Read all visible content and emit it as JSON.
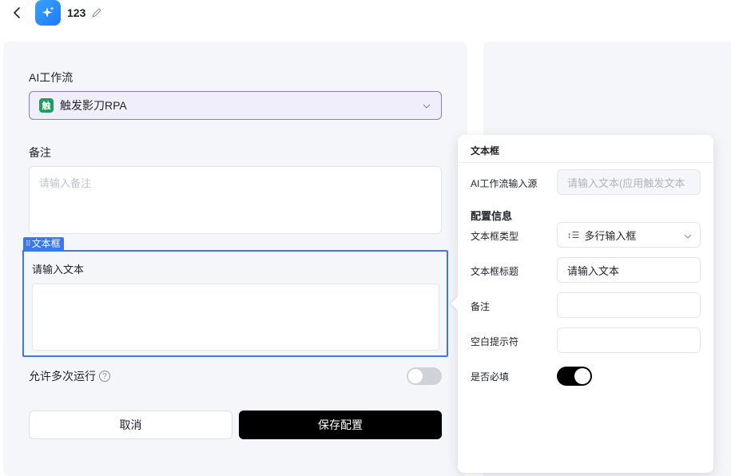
{
  "header": {
    "title": "123",
    "back_icon": "chevron-left-icon",
    "edit_icon": "pencil-icon",
    "app_icon": "sparkle-icon"
  },
  "form": {
    "workflow_label": "AI工作流",
    "workflow_value": "触发影刀RPA",
    "workflow_icon_text": "触",
    "remark_label": "备注",
    "remark_placeholder": "请输入备注",
    "textbox_tag": "文本框",
    "textbox_label": "请输入文本",
    "multi_run_label": "允许多次运行",
    "multi_run_enabled": false,
    "cancel_label": "取消",
    "save_label": "保存配置"
  },
  "popover": {
    "title": "文本框",
    "source_label": "AI工作流输入源",
    "source_placeholder": "请输入文本(应用触发文本",
    "config_section": "配置信息",
    "type_label": "文本框类型",
    "type_value": "多行输入框",
    "title_label": "文本框标题",
    "title_value": "请输入文本",
    "remark_label": "备注",
    "remark_value": "",
    "placeholder_label": "空白提示符",
    "placeholder_value": "",
    "required_label": "是否必填",
    "required_enabled": true
  },
  "colors": {
    "accent": "#3b78f0",
    "workflow_border": "#8e7cc3",
    "workflow_icon": "#1b9e5a"
  }
}
